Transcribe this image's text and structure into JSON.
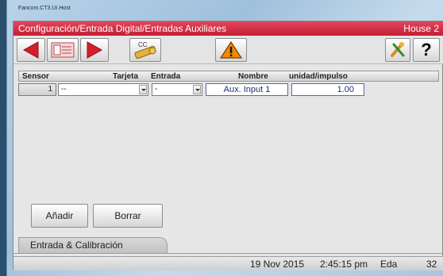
{
  "window": {
    "title": "Fancom.CT3.UI.Host"
  },
  "titlebar": {
    "path": "Configuración/Entrada Digital/Entradas Auxiliares",
    "house": "House 2"
  },
  "toolbar": {
    "back_icon": "left-arrow-icon",
    "menu_icon": "list-card-icon",
    "forward_icon": "right-arrow-icon",
    "cc_icon": "cc-key-icon",
    "cc_label": "CC",
    "alarm_icon": "warning-icon",
    "tools_icon": "tools-icon",
    "help_label": "?"
  },
  "table": {
    "headers": [
      "Sensor",
      "Tarjeta",
      "Entrada",
      "Nombre",
      "unidad/impulso"
    ],
    "rows": [
      {
        "sensor": "1",
        "tarjeta": "--",
        "entrada": "-",
        "nombre": "Aux. Input 1",
        "unidad": "1.00"
      }
    ]
  },
  "buttons": {
    "add": "Añadir",
    "delete": "Borrar"
  },
  "tabs": [
    {
      "label": "Entrada & Calibración",
      "active": true
    }
  ],
  "status": {
    "date": "19 Nov 2015",
    "time": "2:45:15 pm",
    "user": "Eda",
    "number": "32"
  },
  "colors": {
    "title_red": "#c21f35",
    "arrow_red": "#d41f2a",
    "warning_orange": "#f08a00",
    "value_blue": "#1d2f7c"
  }
}
